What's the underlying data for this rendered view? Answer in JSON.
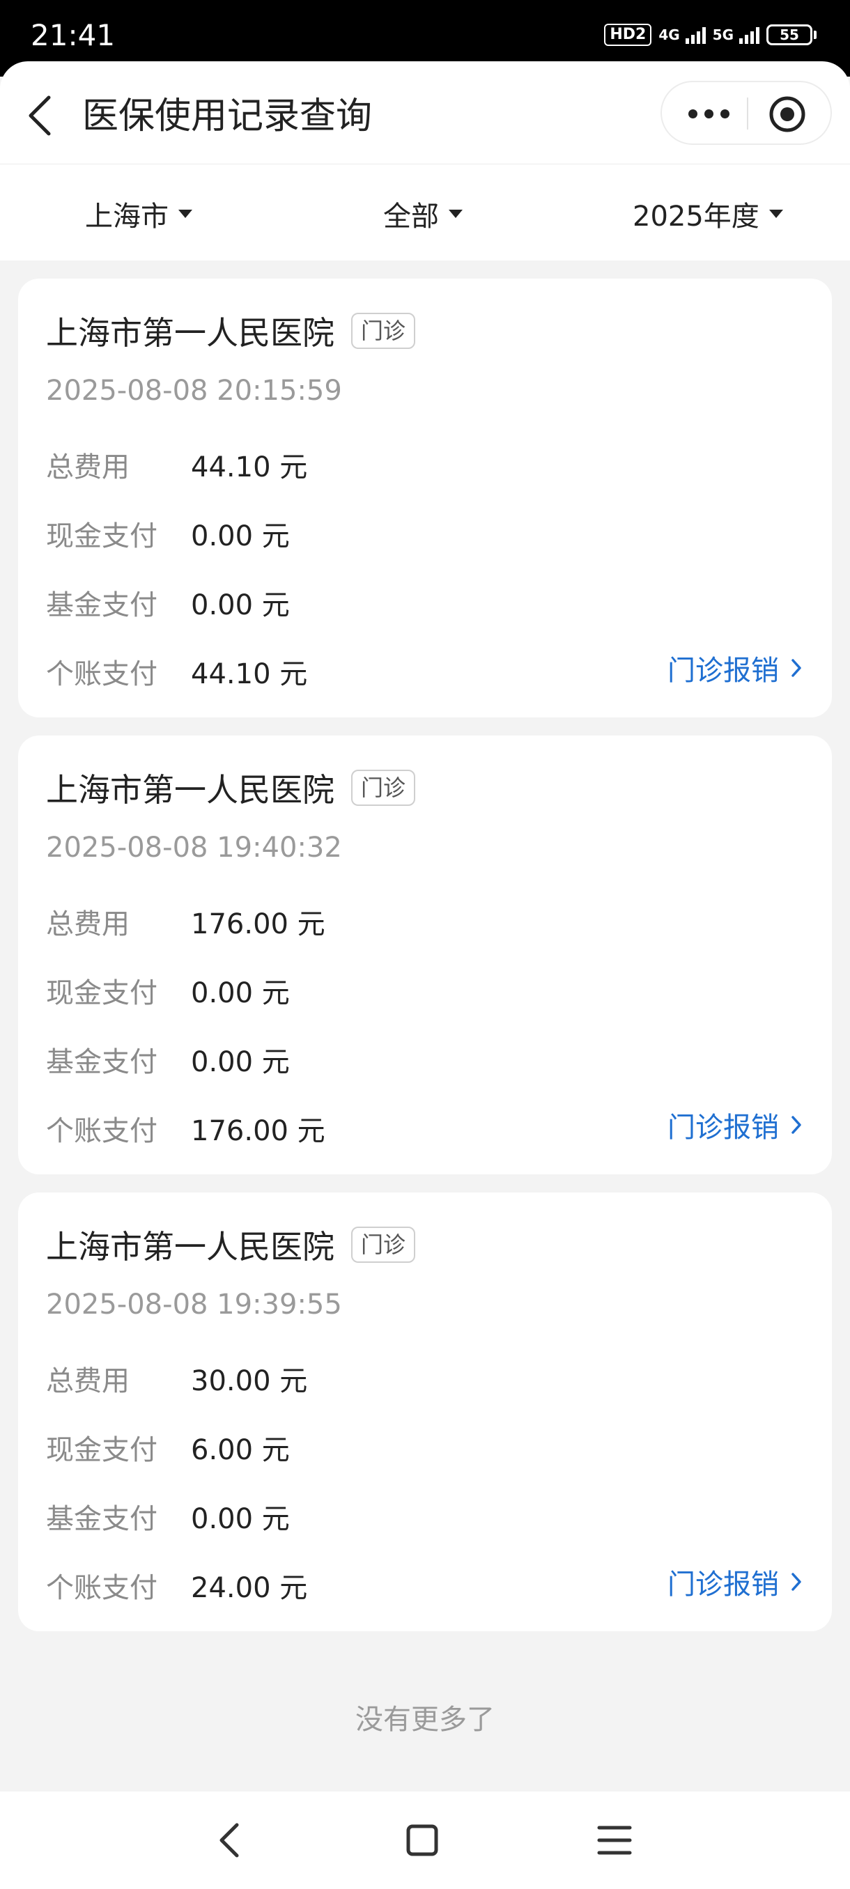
{
  "status_bar": {
    "time": "21:41",
    "hd_badge": "HD2",
    "network_1": "4G",
    "network_2": "5G",
    "battery": "55"
  },
  "header": {
    "title": "医保使用记录查询",
    "icons": [
      "back-icon",
      "more-icon",
      "target-icon"
    ]
  },
  "filters": {
    "city": "上海市",
    "type": "全部",
    "year": "2025年度"
  },
  "labels": {
    "total": "总费用",
    "cash": "现金支付",
    "fund": "基金支付",
    "personal": "个账支付"
  },
  "records": [
    {
      "hospital": "上海市第一人民医院",
      "tag": "门诊",
      "datetime": "2025-08-08 20:15:59",
      "total": "44.10 元",
      "cash": "0.00 元",
      "fund": "0.00 元",
      "personal": "44.10 元",
      "action": "门诊报销"
    },
    {
      "hospital": "上海市第一人民医院",
      "tag": "门诊",
      "datetime": "2025-08-08 19:40:32",
      "total": "176.00 元",
      "cash": "0.00 元",
      "fund": "0.00 元",
      "personal": "176.00 元",
      "action": "门诊报销"
    },
    {
      "hospital": "上海市第一人民医院",
      "tag": "门诊",
      "datetime": "2025-08-08 19:39:55",
      "total": "30.00 元",
      "cash": "6.00 元",
      "fund": "0.00 元",
      "personal": "24.00 元",
      "action": "门诊报销"
    }
  ],
  "footer": {
    "no_more": "没有更多了"
  },
  "colors": {
    "accent": "#1f6fd1",
    "background": "#f3f3f3"
  }
}
